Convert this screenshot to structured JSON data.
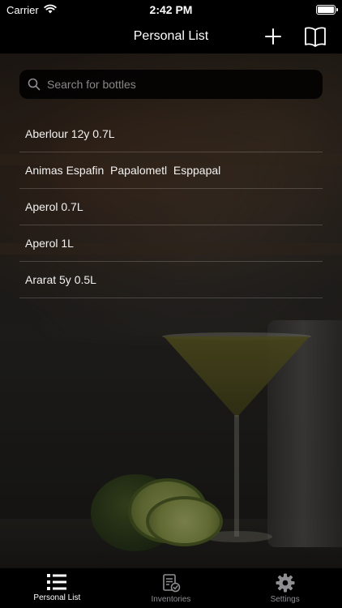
{
  "status": {
    "carrier": "Carrier",
    "time": "2:42 PM"
  },
  "nav": {
    "title": "Personal List",
    "add_icon": "plus-icon",
    "book_icon": "book-icon"
  },
  "search": {
    "placeholder": "Search for bottles",
    "value": ""
  },
  "list": {
    "items": [
      {
        "label": "Aberlour 12y 0.7L"
      },
      {
        "label": "Animas Espafin  Papalometl  Esppapal"
      },
      {
        "label": "Aperol 0.7L"
      },
      {
        "label": "Aperol 1L"
      },
      {
        "label": "Ararat 5y 0.5L"
      }
    ]
  },
  "tabs": [
    {
      "label": "Personal List",
      "icon": "list-icon",
      "active": true
    },
    {
      "label": "Inventories",
      "icon": "clipboard-check-icon",
      "active": false
    },
    {
      "label": "Settings",
      "icon": "gear-icon",
      "active": false
    }
  ],
  "colors": {
    "accent": "#ffffff",
    "inactive": "#8e8e93",
    "bar_bg": "#000000"
  }
}
